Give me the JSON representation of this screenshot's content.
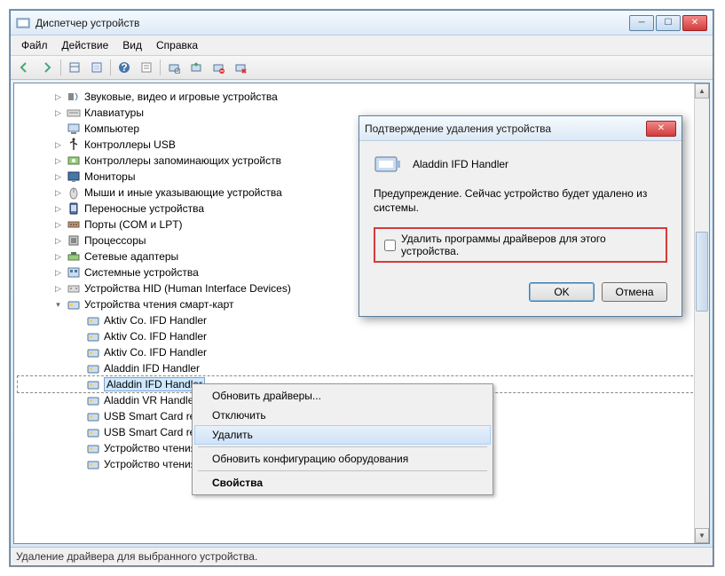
{
  "window": {
    "title": "Диспетчер устройств"
  },
  "menu": {
    "file": "Файл",
    "action": "Действие",
    "view": "Вид",
    "help": "Справка"
  },
  "tree": [
    {
      "indent": 1,
      "exp": "▷",
      "icon": "sound",
      "label": "Звуковые, видео и игровые устройства"
    },
    {
      "indent": 1,
      "exp": "▷",
      "icon": "keyboard",
      "label": "Клавиатуры"
    },
    {
      "indent": 1,
      "exp": "",
      "icon": "computer",
      "label": "Компьютер"
    },
    {
      "indent": 1,
      "exp": "▷",
      "icon": "usb",
      "label": "Контроллеры USB"
    },
    {
      "indent": 1,
      "exp": "▷",
      "icon": "storage",
      "label": "Контроллеры запоминающих устройств"
    },
    {
      "indent": 1,
      "exp": "▷",
      "icon": "monitor",
      "label": "Мониторы"
    },
    {
      "indent": 1,
      "exp": "▷",
      "icon": "mouse",
      "label": "Мыши и иные указывающие устройства"
    },
    {
      "indent": 1,
      "exp": "▷",
      "icon": "portable",
      "label": "Переносные устройства"
    },
    {
      "indent": 1,
      "exp": "▷",
      "icon": "port",
      "label": "Порты (COM и LPT)"
    },
    {
      "indent": 1,
      "exp": "▷",
      "icon": "cpu",
      "label": "Процессоры"
    },
    {
      "indent": 1,
      "exp": "▷",
      "icon": "net",
      "label": "Сетевые адаптеры"
    },
    {
      "indent": 1,
      "exp": "▷",
      "icon": "system",
      "label": "Системные устройства"
    },
    {
      "indent": 1,
      "exp": "▷",
      "icon": "hid",
      "label": "Устройства HID (Human Interface Devices)"
    },
    {
      "indent": 1,
      "exp": "▾",
      "icon": "smartcard",
      "label": "Устройства чтения смарт-карт"
    },
    {
      "indent": 2,
      "exp": "",
      "icon": "reader",
      "label": "Aktiv Co. IFD Handler"
    },
    {
      "indent": 2,
      "exp": "",
      "icon": "reader",
      "label": "Aktiv Co. IFD Handler"
    },
    {
      "indent": 2,
      "exp": "",
      "icon": "reader",
      "label": "Aktiv Co. IFD Handler"
    },
    {
      "indent": 2,
      "exp": "",
      "icon": "reader",
      "label": "Aladdin IFD Handler"
    },
    {
      "indent": 2,
      "exp": "",
      "icon": "reader",
      "label": "Aladdin IFD Handler",
      "selected": true
    },
    {
      "indent": 2,
      "exp": "",
      "icon": "reader",
      "label": "Aladdin VR Handler"
    },
    {
      "indent": 2,
      "exp": "",
      "icon": "reader",
      "label": "USB Smart Card rea"
    },
    {
      "indent": 2,
      "exp": "",
      "icon": "reader",
      "label": "USB Smart Card rea"
    },
    {
      "indent": 2,
      "exp": "",
      "icon": "reader",
      "label": "Устройство чтения"
    },
    {
      "indent": 2,
      "exp": "",
      "icon": "reader",
      "label": "Устройство чтения"
    }
  ],
  "context_menu": {
    "update_drivers": "Обновить драйверы...",
    "disable": "Отключить",
    "uninstall": "Удалить",
    "scan_hw": "Обновить конфигурацию оборудования",
    "properties": "Свойства"
  },
  "dialog": {
    "title": "Подтверждение удаления устройства",
    "device_name": "Aladdin IFD Handler",
    "warning": "Предупреждение. Сейчас устройство будет удалено из системы.",
    "checkbox_label": "Удалить программы драйверов для этого устройства.",
    "ok": "OK",
    "cancel": "Отмена"
  },
  "status": "Удаление драйвера для выбранного устройства."
}
